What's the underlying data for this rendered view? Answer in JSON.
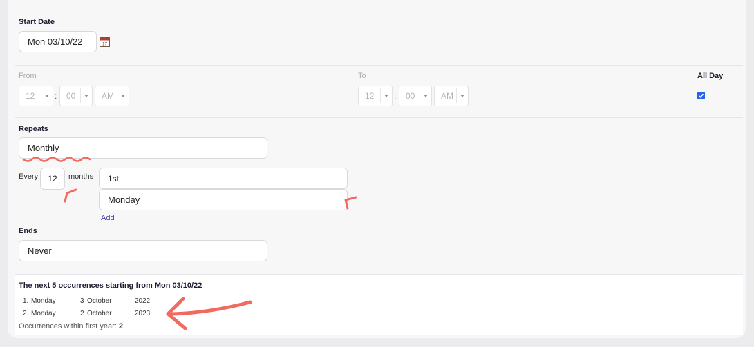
{
  "start_date": {
    "label": "Start Date",
    "value": "Mon 03/10/22"
  },
  "time_range": {
    "from_label": "From",
    "to_label": "To",
    "all_day_label": "All Day",
    "all_day_checked": true,
    "from": {
      "hour": "12",
      "separator": ":",
      "minute": "00",
      "ampm": "AM"
    },
    "to": {
      "hour": "12",
      "separator": ":",
      "minute": "00",
      "ampm": "AM"
    }
  },
  "repeats": {
    "label": "Repeats",
    "value": "Monthly",
    "every_label": "Every",
    "every_value": "12",
    "unit_label": "months",
    "ordinal_value": "1st",
    "weekday_value": "Monday",
    "add_label": "Add"
  },
  "ends": {
    "label": "Ends",
    "value": "Never"
  },
  "occurrences": {
    "heading": "The next 5 occurrences starting from Mon 03/10/22",
    "rows": [
      {
        "index": "1.",
        "weekday": "Monday",
        "day": "3",
        "month": "October",
        "year": "2022"
      },
      {
        "index": "2.",
        "weekday": "Monday",
        "day": "2",
        "month": "October",
        "year": "2023"
      }
    ],
    "first_year_label": "Occurrences within first year:",
    "first_year_count": "2"
  },
  "colors": {
    "annotation": "#f26a5e",
    "checkbox": "#2563eb",
    "link": "#3d3da8"
  }
}
